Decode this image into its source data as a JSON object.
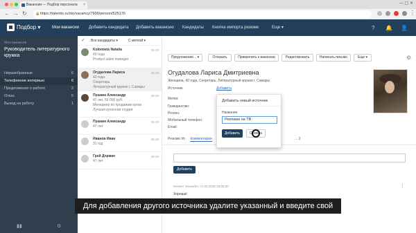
{
  "browser": {
    "tab_title": "Вакансии — Подбор персонала",
    "url": "https://talentix.ru/sto/vacancy/7999/person/525176"
  },
  "nav": {
    "logo": "Подбор",
    "items": [
      "Мои вакансии",
      "Добавить кандидата",
      "Добавить вакансию",
      "Кандидаты",
      "Кнопка импорта резюме",
      "Еще"
    ]
  },
  "sidebar": {
    "subtitle": "Моя вакансия",
    "title": "Руководитель литературного кружка",
    "stages": [
      {
        "label": "Неразобранные",
        "count": "6"
      },
      {
        "label": "Телефонное интервью",
        "count": "6"
      },
      {
        "label": "Предложение о работе",
        "count": "2"
      },
      {
        "label": "Отказ",
        "count": "5"
      },
      {
        "label": "Выход на работу",
        "count": "1"
      }
    ]
  },
  "list": {
    "filter_all": "Все кандидаты",
    "filter_tag": "С меткой",
    "candidates": [
      {
        "name": "Kolomiets Natalia",
        "age": "43 года",
        "line1": "Product sales manager",
        "line2": "Headhunter",
        "date": "20.10"
      },
      {
        "name": "Огудалова Лариса",
        "age": "42 года",
        "line1": "Секретарь",
        "line2": "Литературный кружок г. Самары",
        "date": "20.10"
      },
      {
        "name": "Пушкин Александр",
        "age": "47 лет, 50 000 руб.",
        "line1": "Менеджер по продажам кухни",
        "line2": "Лучшая кухонная студия",
        "date": "20.10"
      },
      {
        "name": "Пушкин Александр",
        "age": "47 лет",
        "line1": "",
        "line2": "",
        "date": "20.10"
      },
      {
        "name": "Иванов Иван",
        "age": "31 год",
        "line1": "",
        "line2": "",
        "date": "20.10"
      },
      {
        "name": "Грей Дорман",
        "age": "47 лет",
        "line1": "",
        "line2": "",
        "date": "20.10"
      }
    ]
  },
  "detail": {
    "actions": [
      "Предложение...",
      "Отказать",
      "Прикрепить к вакансии",
      "Редактировать",
      "Написать письмо",
      "Еще"
    ],
    "name": "Огудалова Лариса Дмитриевна",
    "info": "Женщина, 42 года, Секретарь, Литературный кружок г. Самары",
    "source_label": "Источник:",
    "source_link": "Добавить",
    "labels": [
      "Метки:",
      "Гражданство:",
      "Регион:",
      "Мобильный телефон:",
      "Email:"
    ],
    "tabs": [
      "Резюме hh",
      "Комментарии",
      "... 2"
    ],
    "add_button": "Добавить",
    "comment_author": "Бенжет Элизабет, 01.02.2018 16:38:30",
    "comment_text": "Хороша!"
  },
  "popup": {
    "title": "Добавить новый источник",
    "field_label": "Название",
    "value": "Реклама на ТВ",
    "add": "Добавить",
    "cancel": "Отмена"
  },
  "subtitle": "Для добавления другого источника удалите указанный и введите свой"
}
